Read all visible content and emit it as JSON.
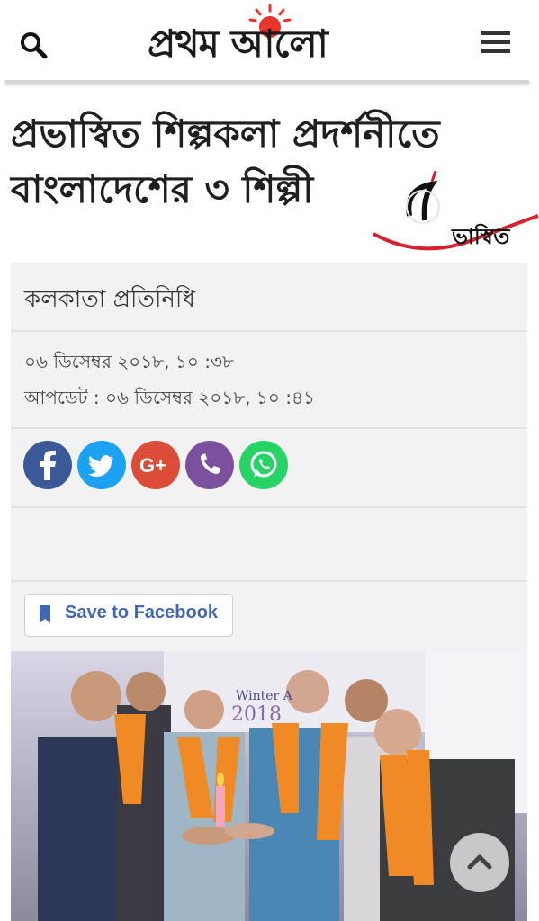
{
  "header": {
    "logo_text": "প্রথম আলো",
    "logo_sun_color": "#e8342a",
    "search_icon": "search-icon",
    "menu_icon": "menu-icon"
  },
  "article": {
    "title_line1": "প্রভাস্বিত শিল্পকলা প্রদর্শনীতে",
    "title_line2": "বাংলাদেশের ৩ শিল্পী",
    "author": "কলকাতা প্রতিনিধি",
    "published": "০৬ ডিসেম্বর ২০১৮, ১০ :৩৮",
    "updated": "আপডেট : ০৬ ডিসেম্বর ২০১৮, ১০ :৪১"
  },
  "brand_overlay": {
    "text": "ভাস্বিত",
    "accent": "#d8202e"
  },
  "share": {
    "buttons": [
      {
        "name": "facebook",
        "icon": "facebook-icon",
        "color": "#3b5998"
      },
      {
        "name": "twitter",
        "icon": "twitter-icon",
        "color": "#1da1f2"
      },
      {
        "name": "google-plus",
        "icon": "google-plus-icon",
        "color": "#dd4b39"
      },
      {
        "name": "viber",
        "icon": "phone-icon",
        "color": "#7b519d"
      },
      {
        "name": "whatsapp",
        "icon": "whatsapp-icon",
        "color": "#25d366"
      }
    ]
  },
  "save": {
    "label": "Save to Facebook",
    "icon": "bookmark-icon",
    "color": "#4267b2"
  },
  "photo": {
    "banner_text": "Winter A",
    "banner_year": "2018"
  },
  "scroll_top": {
    "icon": "chevron-up-icon"
  }
}
